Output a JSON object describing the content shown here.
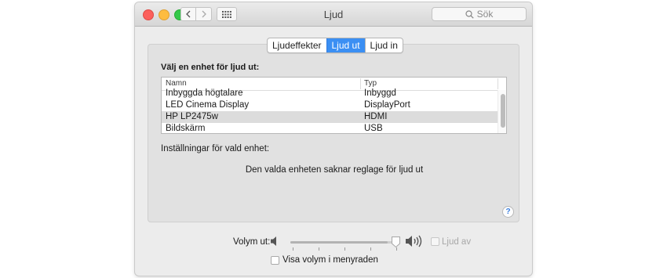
{
  "window": {
    "title": "Ljud"
  },
  "search": {
    "placeholder": "Sök"
  },
  "tabs": [
    {
      "label": "Ljudeffekter",
      "active": false
    },
    {
      "label": "Ljud ut",
      "active": true
    },
    {
      "label": "Ljud in",
      "active": false
    }
  ],
  "output": {
    "heading": "Välj en enhet för ljud ut:",
    "columns": {
      "name": "Namn",
      "type": "Typ"
    },
    "devices": [
      {
        "name": "Inbyggda högtalare",
        "type": "Inbyggd"
      },
      {
        "name": "LED Cinema Display",
        "type": "DisplayPort"
      },
      {
        "name": "HP LP2475w",
        "type": "HDMI",
        "selected": true
      },
      {
        "name": "Bildskärm",
        "type": "USB"
      }
    ],
    "settings_label": "Inställningar för vald enhet:",
    "no_controls_message": "Den valda enheten saknar reglage för ljud ut"
  },
  "help": {
    "label": "?"
  },
  "volume": {
    "label": "Volym ut:",
    "level": 0.9,
    "mute_label": "Ljud av",
    "mute_checked": false,
    "show_in_menubar_label": "Visa volym i menyraden",
    "show_in_menubar_checked": false
  },
  "colors": {
    "accent": "#3b8ff3",
    "close": "#fc605c",
    "minimize": "#fdbc40",
    "maximize": "#34c84a"
  },
  "icons": [
    "close-icon",
    "minimize-icon",
    "maximize-icon",
    "chevron-left-icon",
    "chevron-right-icon",
    "grid-icon",
    "search-icon",
    "speaker-low-icon",
    "speaker-high-icon",
    "help-icon"
  ]
}
